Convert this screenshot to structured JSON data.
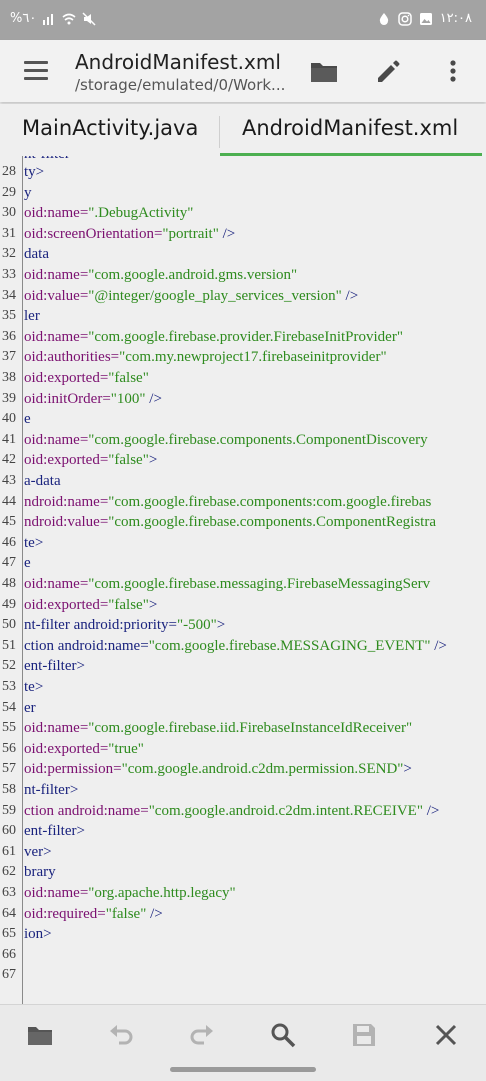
{
  "status_bar": {
    "battery": "%٦٠",
    "time": "١٢:٠٨"
  },
  "toolbar": {
    "title": "AndroidManifest.xml",
    "subtitle": "/storage/emulated/0/Work...",
    "icons": [
      "menu-icon",
      "folder-icon",
      "edit-icon",
      "more-vert-icon"
    ]
  },
  "tabs": [
    {
      "label": "MainActivity.java",
      "active": false
    },
    {
      "label": "AndroidManifest.xml",
      "active": true
    }
  ],
  "editor": {
    "partial_top_line": "nt-filter",
    "lines": [
      {
        "num": "28",
        "segments": [
          {
            "t": "ty>",
            "k": "tag"
          }
        ]
      },
      {
        "num": "29",
        "segments": [
          {
            "t": "y",
            "k": "tag"
          }
        ]
      },
      {
        "num": "30",
        "segments": [
          {
            "t": "oid:name=",
            "k": "attr"
          },
          {
            "t": "\".DebugActivity\"",
            "k": "str"
          }
        ]
      },
      {
        "num": "31",
        "segments": [
          {
            "t": "oid:screenOrientation=",
            "k": "attr"
          },
          {
            "t": "\"portrait\"",
            "k": "str"
          },
          {
            "t": " />",
            "k": "tag"
          }
        ]
      },
      {
        "num": "32",
        "segments": [
          {
            "t": "data",
            "k": "tag"
          }
        ]
      },
      {
        "num": "33",
        "segments": [
          {
            "t": "oid:name=",
            "k": "attr"
          },
          {
            "t": "\"com.google.android.gms.version\"",
            "k": "str"
          }
        ]
      },
      {
        "num": "34",
        "segments": [
          {
            "t": "oid:value=",
            "k": "attr"
          },
          {
            "t": "\"@integer/google_play_services_version\"",
            "k": "str"
          },
          {
            "t": " />",
            "k": "tag"
          }
        ]
      },
      {
        "num": "35",
        "segments": [
          {
            "t": "ler",
            "k": "tag"
          }
        ]
      },
      {
        "num": "36",
        "segments": [
          {
            "t": "oid:name=",
            "k": "attr"
          },
          {
            "t": "\"com.google.firebase.provider.FirebaseInitProvider\"",
            "k": "str"
          }
        ]
      },
      {
        "num": "37",
        "segments": [
          {
            "t": "oid:authorities=",
            "k": "attr"
          },
          {
            "t": "\"com.my.newproject17.firebaseinitprovider\"",
            "k": "str"
          }
        ]
      },
      {
        "num": "38",
        "segments": [
          {
            "t": "oid:exported=",
            "k": "attr"
          },
          {
            "t": "\"false\"",
            "k": "str"
          }
        ]
      },
      {
        "num": "39",
        "segments": [
          {
            "t": "oid:initOrder=",
            "k": "attr"
          },
          {
            "t": "\"100\"",
            "k": "str"
          },
          {
            "t": " />",
            "k": "tag"
          }
        ]
      },
      {
        "num": "40",
        "segments": [
          {
            "t": "e",
            "k": "tag"
          }
        ]
      },
      {
        "num": "41",
        "segments": [
          {
            "t": "oid:name=",
            "k": "attr"
          },
          {
            "t": "\"com.google.firebase.components.ComponentDiscovery",
            "k": "str"
          }
        ]
      },
      {
        "num": "42",
        "segments": [
          {
            "t": "oid:exported=",
            "k": "attr"
          },
          {
            "t": "\"false\"",
            "k": "str"
          },
          {
            "t": ">",
            "k": "tag"
          }
        ]
      },
      {
        "num": "43",
        "segments": [
          {
            "t": "a-data",
            "k": "tag"
          }
        ]
      },
      {
        "num": "44",
        "segments": [
          {
            "t": "ndroid:name=",
            "k": "attr"
          },
          {
            "t": "\"com.google.firebase.components:com.google.firebas",
            "k": "str"
          }
        ]
      },
      {
        "num": "45",
        "segments": [
          {
            "t": "ndroid:value=",
            "k": "attr"
          },
          {
            "t": "\"com.google.firebase.components.ComponentRegistra",
            "k": "str"
          }
        ]
      },
      {
        "num": "46",
        "segments": [
          {
            "t": "te>",
            "k": "tag"
          }
        ]
      },
      {
        "num": "47",
        "segments": [
          {
            "t": "e",
            "k": "tag"
          }
        ]
      },
      {
        "num": "48",
        "segments": [
          {
            "t": "oid:name=",
            "k": "attr"
          },
          {
            "t": "\"com.google.firebase.messaging.FirebaseMessagingServ",
            "k": "str"
          }
        ]
      },
      {
        "num": "49",
        "segments": [
          {
            "t": "oid:exported=",
            "k": "attr"
          },
          {
            "t": "\"false\"",
            "k": "str"
          },
          {
            "t": ">",
            "k": "tag"
          }
        ]
      },
      {
        "num": "50",
        "segments": [
          {
            "t": "nt-filter android:priority=",
            "k": "tag"
          },
          {
            "t": "\"-500\"",
            "k": "str"
          },
          {
            "t": ">",
            "k": "tag"
          }
        ]
      },
      {
        "num": "51",
        "segments": [
          {
            "t": "ction android:name=",
            "k": "tag"
          },
          {
            "t": "\"com.google.firebase.MESSAGING_EVENT\"",
            "k": "str"
          },
          {
            "t": " />",
            "k": "tag"
          }
        ]
      },
      {
        "num": "52",
        "segments": [
          {
            "t": "ent-filter>",
            "k": "tag"
          }
        ]
      },
      {
        "num": "53",
        "segments": [
          {
            "t": "te>",
            "k": "tag"
          }
        ]
      },
      {
        "num": "54",
        "segments": [
          {
            "t": "er",
            "k": "tag"
          }
        ]
      },
      {
        "num": "55",
        "segments": [
          {
            "t": "oid:name=",
            "k": "attr"
          },
          {
            "t": "\"com.google.firebase.iid.FirebaseInstanceIdReceiver\"",
            "k": "str"
          }
        ]
      },
      {
        "num": "56",
        "segments": [
          {
            "t": "oid:exported=",
            "k": "attr"
          },
          {
            "t": "\"true\"",
            "k": "str"
          }
        ]
      },
      {
        "num": "57",
        "segments": [
          {
            "t": "oid:permission=",
            "k": "attr"
          },
          {
            "t": "\"com.google.android.c2dm.permission.SEND\"",
            "k": "str"
          },
          {
            "t": ">",
            "k": "tag"
          }
        ]
      },
      {
        "num": "58",
        "segments": [
          {
            "t": "nt-filter>",
            "k": "tag"
          }
        ]
      },
      {
        "num": "59",
        "segments": [
          {
            "t": "ction android:name=",
            "k": "attr"
          },
          {
            "t": "\"com.google.android.c2dm.intent.RECEIVE\"",
            "k": "str"
          },
          {
            "t": " />",
            "k": "tag"
          }
        ]
      },
      {
        "num": "60",
        "segments": [
          {
            "t": "ent-filter>",
            "k": "tag"
          }
        ]
      },
      {
        "num": "61",
        "segments": [
          {
            "t": "ver>",
            "k": "tag"
          }
        ]
      },
      {
        "num": "62",
        "segments": [
          {
            "t": "brary",
            "k": "tag"
          }
        ]
      },
      {
        "num": "63",
        "segments": [
          {
            "t": "oid:name=",
            "k": "attr"
          },
          {
            "t": "\"org.apache.http.legacy\"",
            "k": "str"
          }
        ]
      },
      {
        "num": "64",
        "segments": [
          {
            "t": "oid:required=",
            "k": "attr"
          },
          {
            "t": "\"false\"",
            "k": "str"
          },
          {
            "t": " />",
            "k": "tag"
          }
        ]
      },
      {
        "num": "65",
        "segments": [
          {
            "t": "ion>",
            "k": "tag"
          }
        ]
      },
      {
        "num": "66",
        "segments": []
      },
      {
        "num": "67",
        "segments": []
      }
    ]
  },
  "bottom_bar": {
    "icons": [
      "folder-icon",
      "undo-icon",
      "redo-icon",
      "search-icon",
      "save-icon",
      "close-icon"
    ]
  },
  "colors": {
    "tag": "#1a237e",
    "attr": "#7b1070",
    "string": "#2e8b1e",
    "accent": "#4caf50"
  }
}
